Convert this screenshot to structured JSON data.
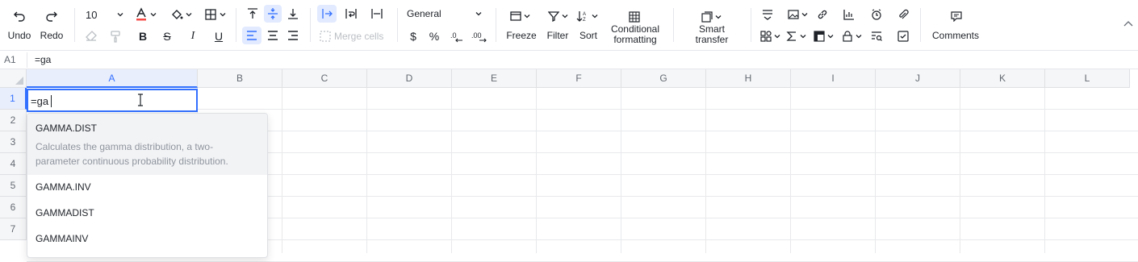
{
  "toolbar": {
    "undo": "Undo",
    "redo": "Redo",
    "font_size": "10",
    "merge_cells": "Merge cells",
    "number_format": "General",
    "currency": "$",
    "percent": "%",
    "freeze": "Freeze",
    "filter": "Filter",
    "sort": "Sort",
    "conditional_formatting_l1": "Conditional",
    "conditional_formatting_l2": "formatting",
    "smart_transfer_l1": "Smart",
    "smart_transfer_l2": "transfer",
    "comments": "Comments",
    "accent_color": "#3370ff",
    "font_color_bar": "#f54a45"
  },
  "formula_bar": {
    "cell_ref": "A1",
    "content": "=ga"
  },
  "grid": {
    "columns": [
      "A",
      "B",
      "C",
      "D",
      "E",
      "F",
      "G",
      "H",
      "I",
      "J",
      "K",
      "L"
    ],
    "rows": [
      "1",
      "2",
      "3",
      "4",
      "5",
      "6",
      "7"
    ],
    "editor_value": "=ga"
  },
  "autocomplete": {
    "items": [
      {
        "name": "GAMMA.DIST",
        "desc_l1": "Calculates the gamma distribution, a two-",
        "desc_l2": "parameter continuous probability distribution."
      },
      {
        "name": "GAMMA.INV"
      },
      {
        "name": "GAMMADIST"
      },
      {
        "name": "GAMMAINV"
      }
    ]
  }
}
